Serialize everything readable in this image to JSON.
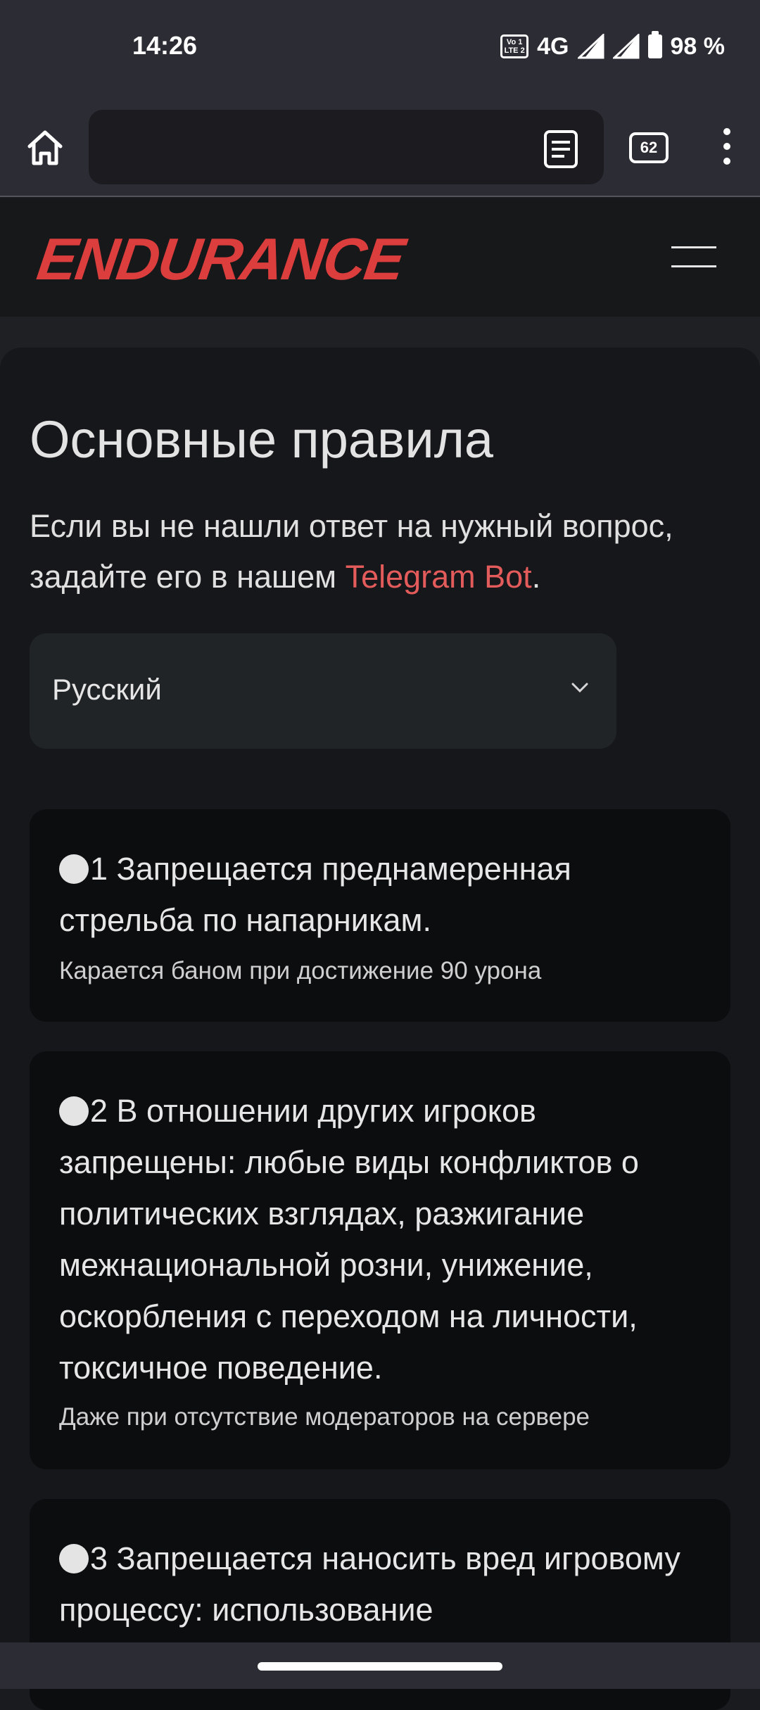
{
  "status": {
    "time": "14:26",
    "volte": "Vo LTE 1 2",
    "network": "4G",
    "battery": "98 %",
    "icons": [
      "volte-icon",
      "signal-icon",
      "signal-icon",
      "battery-icon"
    ]
  },
  "browser": {
    "tab_count": "62",
    "url": "",
    "icons": [
      "home-icon",
      "reader-mode-icon",
      "tabs-icon",
      "more-vert-icon"
    ]
  },
  "site": {
    "logo": "ENDURANCE",
    "menu_icon": "hamburger-icon"
  },
  "page": {
    "title": "Основные правила",
    "intro_text": "Если вы не нашли ответ на нужный вопрос, задайте его в нашем ",
    "intro_link": "Telegram Bot",
    "intro_end": ".",
    "language": {
      "selected": "Русский",
      "icon": "chevron-down-icon"
    },
    "rules": [
      {
        "title": "1 Запрещается преднамеренная стрельба по напарникам.",
        "note": "Карается баном при достижение 90 урона"
      },
      {
        "title": "2 В отношении других игроков запрещены: любые виды конфликтов о политических взглядах, разжигание межнациональной розни, унижение, оскорбления с переходом на личности, токсичное поведение.",
        "note": "Даже при отсутствие модераторов на сервере"
      },
      {
        "title": "3 Запрещается наносить вред игровому процессу: использование"
      }
    ]
  },
  "colors": {
    "accent": "#dc3d3d",
    "link": "#e45b5b",
    "background": "#16171a",
    "card": "#0c0d0e"
  }
}
